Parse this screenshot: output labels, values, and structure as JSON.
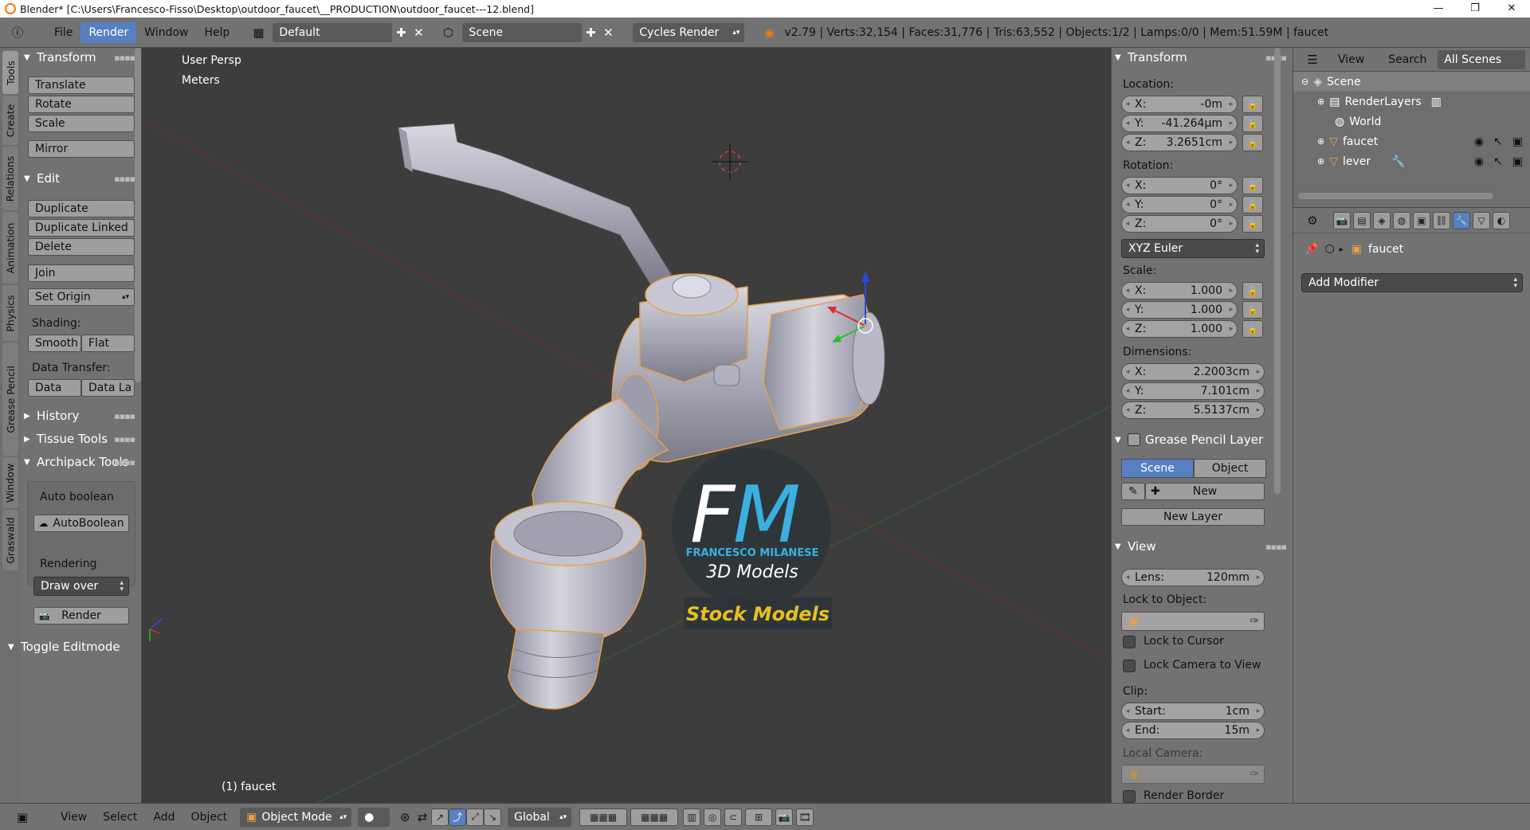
{
  "window": {
    "title": "Blender* [C:\\Users\\Francesco-Fisso\\Desktop\\outdoor_faucet\\__PRODUCTION\\outdoor_faucet---12.blend]",
    "controls": [
      "—",
      "❐",
      "✕"
    ]
  },
  "menubar": {
    "info_icon": "ⓘ",
    "menus": [
      "File",
      "Render",
      "Window",
      "Help"
    ],
    "active_menu": "Render",
    "layout": "Default",
    "scene": "Scene",
    "engine": "Cycles Render",
    "stats": "v2.79 | Verts:32,154 | Faces:31,776 | Tris:63,552 | Objects:1/2 | Lamps:0/0 | Mem:51.59M | faucet"
  },
  "left_tabs": [
    "Tools",
    "Create",
    "Relations",
    "Animation",
    "Physics",
    "Grease Pencil",
    "Window",
    "Graswald"
  ],
  "toolshelf": {
    "transform": {
      "title": "Transform",
      "buttons": [
        "Translate",
        "Rotate",
        "Scale",
        "Mirror"
      ]
    },
    "edit": {
      "title": "Edit",
      "buttons": [
        "Duplicate",
        "Duplicate Linked",
        "Delete",
        "Join"
      ],
      "set_origin": "Set Origin"
    },
    "shading": {
      "label": "Shading:",
      "smooth": "Smooth",
      "flat": "Flat"
    },
    "data_transfer": {
      "label": "Data Transfer:",
      "data": "Data",
      "data_la": "Data La"
    },
    "collapsed": [
      "History",
      "Tissue Tools"
    ],
    "archipack": {
      "title": "Archipack Tools",
      "auto_boolean_label": "Auto boolean",
      "auto_boolean_btn": "AutoBoolean",
      "rendering_label": "Rendering",
      "draw_over": "Draw over",
      "render_btn": "Render"
    },
    "toggle_editmode": "Toggle Editmode"
  },
  "viewport": {
    "view_name": "User Persp",
    "units": "Meters",
    "object_label": "(1) faucet",
    "watermark": {
      "letters": "FM",
      "name": "FRANCESCO MILANESE",
      "sub": "3D Models",
      "tag": "Stock Models"
    }
  },
  "npanel": {
    "transform_title": "Transform",
    "location_label": "Location:",
    "location": [
      {
        "axis": "X:",
        "value": "-0m"
      },
      {
        "axis": "Y:",
        "value": "-41.264µm"
      },
      {
        "axis": "Z:",
        "value": "3.2651cm"
      }
    ],
    "rotation_label": "Rotation:",
    "rotation": [
      {
        "axis": "X:",
        "value": "0°"
      },
      {
        "axis": "Y:",
        "value": "0°"
      },
      {
        "axis": "Z:",
        "value": "0°"
      }
    ],
    "rotation_mode": "XYZ Euler",
    "scale_label": "Scale:",
    "scale": [
      {
        "axis": "X:",
        "value": "1.000"
      },
      {
        "axis": "Y:",
        "value": "1.000"
      },
      {
        "axis": "Z:",
        "value": "1.000"
      }
    ],
    "dimensions_label": "Dimensions:",
    "dimensions": [
      {
        "axis": "X:",
        "value": "2.2003cm"
      },
      {
        "axis": "Y:",
        "value": "7.101cm"
      },
      {
        "axis": "Z:",
        "value": "5.5137cm"
      }
    ],
    "grease_title": "Grease Pencil Layer",
    "grease_scene": "Scene",
    "grease_object": "Object",
    "grease_new": "New",
    "grease_new_layer": "New Layer",
    "view_title": "View",
    "lens_label": "Lens:",
    "lens_value": "120mm",
    "lock_to_object": "Lock to Object:",
    "lock_to_cursor": "Lock to Cursor",
    "lock_camera": "Lock Camera to View",
    "clip_label": "Clip:",
    "clip_start_label": "Start:",
    "clip_start": "1cm",
    "clip_end_label": "End:",
    "clip_end": "15m",
    "local_camera": "Local Camera:",
    "render_border": "Render Border"
  },
  "outliner": {
    "view": "View",
    "search": "Search",
    "filter": "All Scenes",
    "items": [
      "Scene",
      "RenderLayers",
      "World",
      "faucet",
      "lever"
    ]
  },
  "properties": {
    "object_name": "faucet",
    "add_modifier": "Add Modifier"
  },
  "bottombar": {
    "menus": [
      "View",
      "Select",
      "Add",
      "Object"
    ],
    "mode": "Object Mode",
    "orientation": "Global"
  },
  "colors": {
    "accent": "#5680c2",
    "selection": "#e8a048",
    "watermark_blue": "#3ab0e0",
    "watermark_gold": "#e8c020"
  }
}
